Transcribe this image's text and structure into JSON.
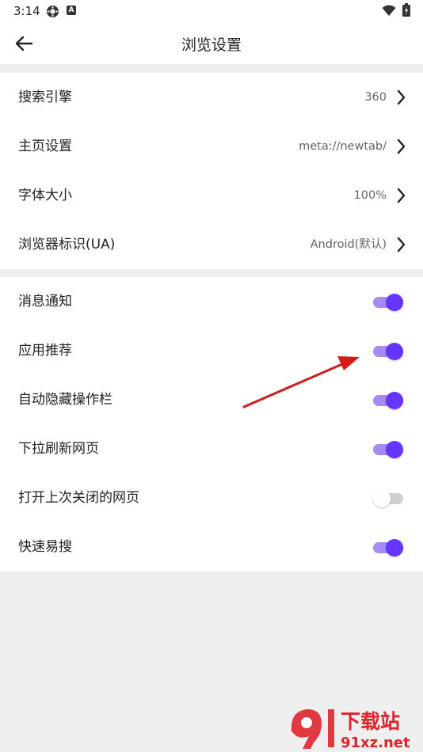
{
  "status_bar": {
    "time": "3:14",
    "icons": [
      "settings-gear-icon",
      "app-a-icon",
      "wifi-icon",
      "battery-icon"
    ],
    "app_badge": "A"
  },
  "app_bar": {
    "title": "浏览设置",
    "back_icon": "arrow-left-icon"
  },
  "colors": {
    "accent": "#6633ff",
    "track_on": "#a68bf5",
    "track_off": "#cfcfcf",
    "thumb_off": "#ffffff",
    "annotation_arrow": "#d21b1b",
    "watermark_red": "#e0242b"
  },
  "settings_group": [
    {
      "label": "搜索引擎",
      "value": "360"
    },
    {
      "label": "主页设置",
      "value": "meta://newtab/"
    },
    {
      "label": "字体大小",
      "value": "100%"
    },
    {
      "label": "浏览器标识(UA)",
      "value": "Android(默认)"
    }
  ],
  "toggle_group": [
    {
      "label": "消息通知",
      "on": true
    },
    {
      "label": "应用推荐",
      "on": true
    },
    {
      "label": "自动隐藏操作栏",
      "on": true
    },
    {
      "label": "下拉刷新网页",
      "on": true
    },
    {
      "label": "打开上次关闭的网页",
      "on": false
    },
    {
      "label": "快速易搜",
      "on": true
    }
  ],
  "watermark": {
    "title": "下载站",
    "url": "91xz.net"
  }
}
